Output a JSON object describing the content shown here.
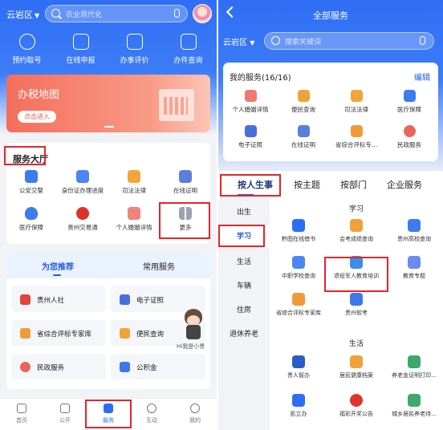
{
  "left": {
    "region": "云岩区",
    "search_placeholder": "农业现代化",
    "quick": [
      "预约取号",
      "在线申报",
      "办事评价",
      "办件查询"
    ],
    "banner": {
      "title": "办税地图",
      "button": "点击进入"
    },
    "hall": {
      "title": "服务大厅",
      "items": [
        "公安交警",
        "身份证办理进度",
        "司法法律",
        "在线证明",
        "医疗保障",
        "贵州交易通",
        "个人婚姻详情",
        "更多"
      ]
    },
    "tabs": [
      "为您推荐",
      "常用服务"
    ],
    "recommend": [
      "贵州人社",
      "电子证照",
      "省综合评标专家库",
      "便民查询",
      "民政服务",
      "公积金"
    ],
    "mascot_label": "Hi我是小贵",
    "nav": [
      "首页",
      "公开",
      "服务",
      "互动",
      "我的"
    ]
  },
  "right": {
    "title": "全部服务",
    "region": "云岩区",
    "search_placeholder": "搜索关键词",
    "my_services": {
      "title": "我的服务(16/16)",
      "edit": "编辑",
      "items": [
        "个人婚姻详情",
        "便民查询",
        "司法法律",
        "医疗保障",
        "电子证照",
        "在线证明",
        "省综合评标专...",
        "民政服务"
      ]
    },
    "tabs": [
      "按人生事",
      "按主题",
      "按部门",
      "企业服务"
    ],
    "categories": [
      "出生",
      "学习",
      "生活",
      "车辆",
      "住房",
      "退休养老"
    ],
    "groups": {
      "study": {
        "title": "学习",
        "items": [
          "黔图在线借书",
          "会考成绩查询",
          "贵州高校查询",
          "中职学校查询",
          "退役军人教育培训",
          "教育专题",
          "省综合评标专家库",
          "贵州软考"
        ]
      },
      "life": {
        "title": "生活",
        "items": [
          "贵人智办",
          "居民健康档案",
          "养老金证明打印...",
          "凯立办",
          "福彩开奖公告",
          "城乡居民养老待..."
        ]
      }
    }
  },
  "colors": {
    "primary": "#2f6ef5",
    "highlight": "#e8232a",
    "banner": "#f46e5c"
  }
}
